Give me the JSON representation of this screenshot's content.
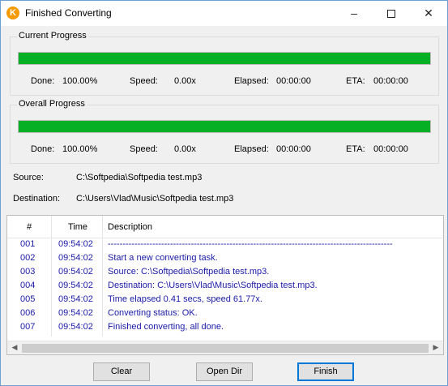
{
  "window": {
    "title": "Finished Converting",
    "icon": "K",
    "controls": {
      "minimize": "–",
      "close": "✕"
    }
  },
  "current_progress": {
    "label": "Current Progress",
    "progress": 1.0,
    "done_label": "Done:",
    "done": "100.00%",
    "speed_label": "Speed:",
    "speed": "0.00x",
    "elapsed_label": "Elapsed:",
    "elapsed": "00:00:00",
    "eta_label": "ETA:",
    "eta": "00:00:00"
  },
  "overall_progress": {
    "label": "Overall Progress",
    "progress": 1.0,
    "done_label": "Done:",
    "done": "100.00%",
    "speed_label": "Speed:",
    "speed": "0.00x",
    "elapsed_label": "Elapsed:",
    "elapsed": "00:00:00",
    "eta_label": "ETA:",
    "eta": "00:00:00"
  },
  "paths": {
    "source_label": "Source:",
    "source": "C:\\Softpedia\\Softpedia test.mp3",
    "destination_label": "Destination:",
    "destination": "C:\\Users\\Vlad\\Music\\Softpedia test.mp3"
  },
  "log": {
    "columns": [
      "#",
      "Time",
      "Description"
    ],
    "rows": [
      [
        "001",
        "09:54:02",
        "------------------------------------------------------------------------------------------------"
      ],
      [
        "002",
        "09:54:02",
        "Start a new converting task."
      ],
      [
        "003",
        "09:54:02",
        "Source:  C:\\Softpedia\\Softpedia test.mp3."
      ],
      [
        "004",
        "09:54:02",
        "Destination: C:\\Users\\Vlad\\Music\\Softpedia test.mp3."
      ],
      [
        "005",
        "09:54:02",
        "Time elapsed 0.41 secs, speed 61.77x."
      ],
      [
        "006",
        "09:54:02",
        "Converting status: OK."
      ],
      [
        "007",
        "09:54:02",
        "Finished converting, all done."
      ]
    ],
    "row_color": "#1a1aa8"
  },
  "buttons": {
    "clear": "Clear",
    "open_dir": "Open Dir",
    "finish": "Finish"
  },
  "colors": {
    "progress_fill": "#06b025",
    "accent": "#0078d7"
  }
}
